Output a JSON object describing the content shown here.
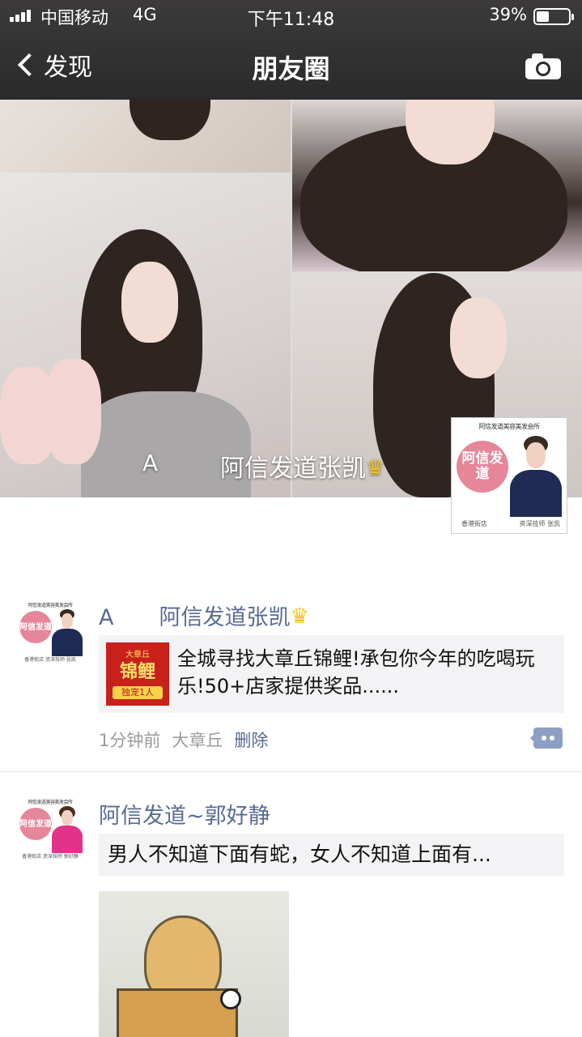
{
  "status_bar": {
    "carrier": "中国移动",
    "network": "4G",
    "time": "下午11:48",
    "battery_pct": "39%",
    "battery_level": 0.39
  },
  "nav": {
    "back_label": "发现",
    "title": "朋友圈",
    "camera_icon": "camera-icon"
  },
  "cover": {
    "owner_initial": "A",
    "owner_name": "阿信发道张凯",
    "crown_icon": "crown-icon"
  },
  "cover_avatar": {
    "header": "阿信发道美容美发会所",
    "circle_text": "阿信发道",
    "footer_left": "香港街店",
    "footer_right": "资深技师 张凯"
  },
  "posts": [
    {
      "user_initial": "A",
      "user_name": "阿信发道张凯",
      "avatar": {
        "header": "阿信发道美容美发会所",
        "circle_text": "阿信发道",
        "footer": "香港街店 资深技师 张凯"
      },
      "link": {
        "thumb_top": "大章丘",
        "thumb_main": "锦鲤",
        "thumb_bottom": "独宠1人",
        "text": "全城寻找大章丘锦鲤!承包你今年的吃喝玩乐!50+店家提供奖品......"
      },
      "time": "1分钟前",
      "location": "大章丘",
      "delete_label": "删除"
    },
    {
      "user_name": "阿信发道~郭好静",
      "avatar": {
        "header": "阿信发道美容美发会所",
        "circle_text": "阿信发道",
        "footer": "香港街店 资深技师 郭好静"
      },
      "text": "男人不知道下面有蛇，女人不知道上面有..."
    }
  ],
  "colors": {
    "link_blue": "#576b95",
    "meta_gray": "#9b9b9b",
    "bubble_bg": "#f3f3f5",
    "nav_bg": "#2d2c2d",
    "brand_pink": "#e6869a"
  }
}
